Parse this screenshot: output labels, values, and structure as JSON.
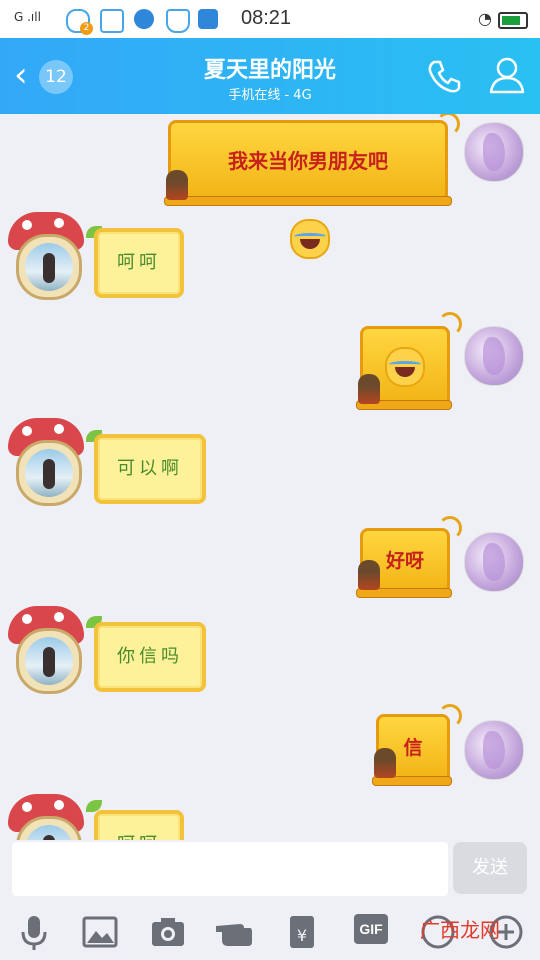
{
  "status_bar": {
    "signal": "G .ıll",
    "time": "08:21",
    "notification_count": "2"
  },
  "header": {
    "back_count": "12",
    "title": "夏天里的阳光",
    "subtitle": "手机在线 - 4G"
  },
  "messages": [
    {
      "side": "right",
      "text": "我来当你男朋友吧",
      "has_emoji": true
    },
    {
      "side": "left",
      "text": "呵呵"
    },
    {
      "side": "right",
      "text": "",
      "has_emoji": true
    },
    {
      "side": "left",
      "text": "可以啊"
    },
    {
      "side": "right",
      "text": "好呀"
    },
    {
      "side": "left",
      "text": "你信吗"
    },
    {
      "side": "right",
      "text": "信"
    },
    {
      "side": "left",
      "text": "呵呵"
    }
  ],
  "input": {
    "placeholder": "",
    "send_label": "发送"
  },
  "toolbar": {
    "gif_label": "GIF",
    "watermark": "广西龙网"
  },
  "icons": [
    "mic-icon",
    "image-icon",
    "camera-icon",
    "hand-icon",
    "red-packet-icon",
    "gif-icon",
    "emoji-icon",
    "plus-icon"
  ]
}
